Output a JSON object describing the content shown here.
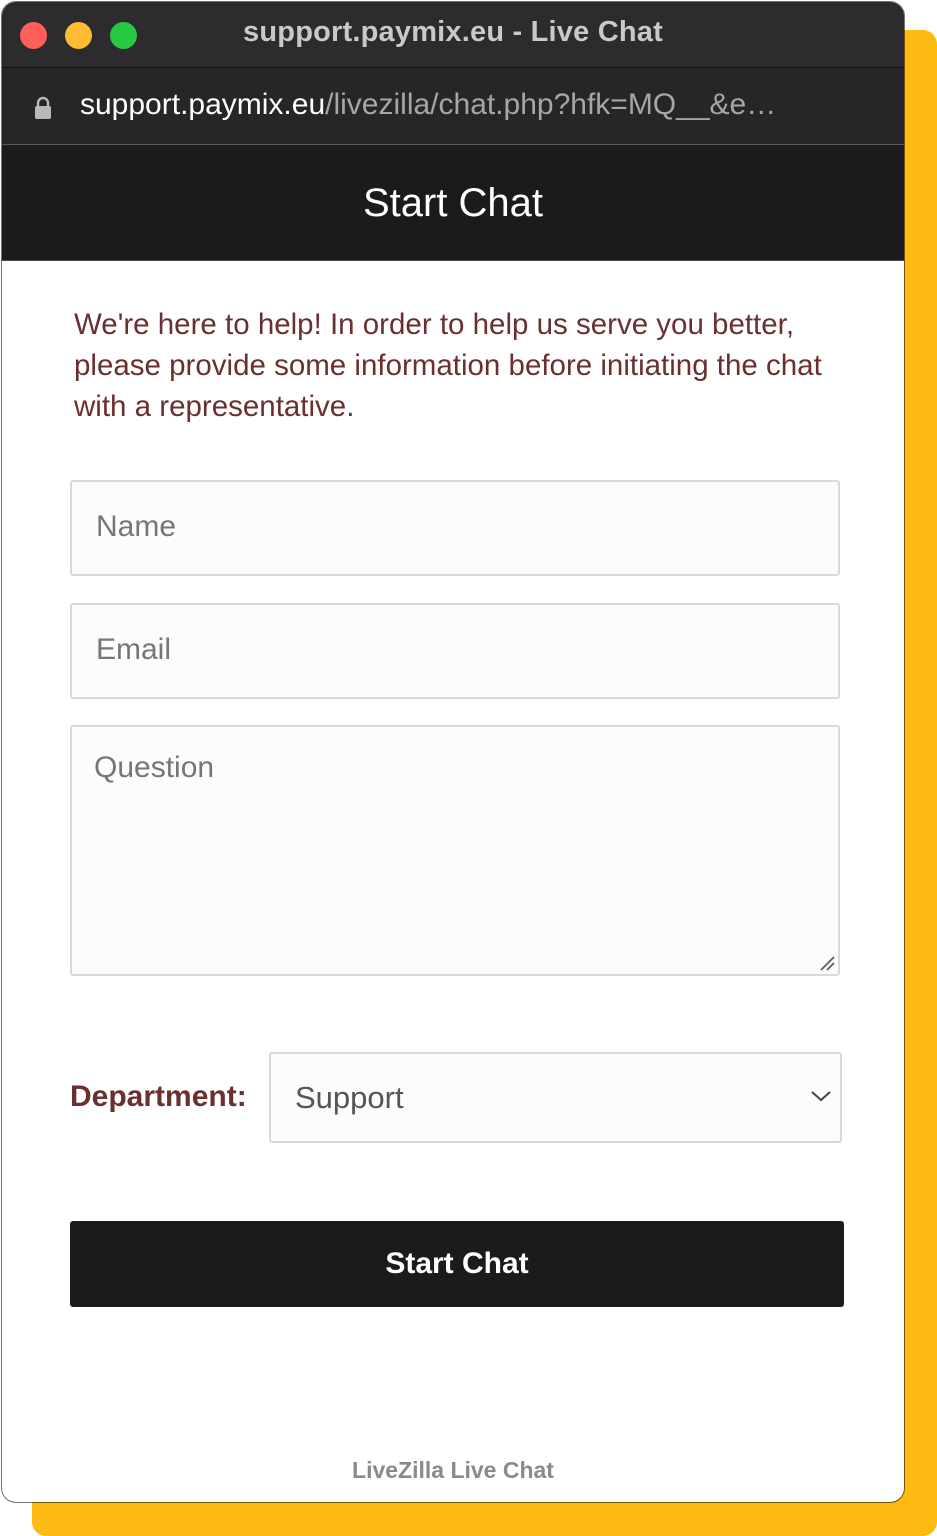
{
  "window": {
    "title": "support.paymix.eu - Live Chat",
    "url_host": "support.paymix.eu",
    "url_path": "/livezilla/chat.php?hfk=MQ__&e…"
  },
  "header": {
    "title": "Start Chat"
  },
  "form": {
    "intro": "We're here to help! In order to help us serve you better, please provide some information before initiating the chat with a representative.",
    "name_placeholder": "Name",
    "email_placeholder": "Email",
    "question_placeholder": "Question",
    "department_label": "Department:",
    "department_value": "Support",
    "submit_label": "Start Chat"
  },
  "footer": {
    "text": "LiveZilla Live Chat"
  },
  "colors": {
    "accent": "#FDBA13",
    "header_bg": "#1b1b1b",
    "label_text": "#6b2f2f"
  },
  "icons": {
    "lock": "lock-icon",
    "chevron": "chevron-down-icon",
    "resize": "resize-handle-icon"
  }
}
